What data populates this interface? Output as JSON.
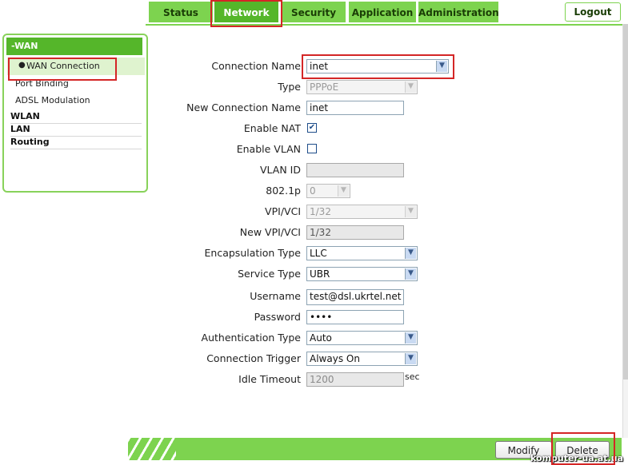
{
  "nav": {
    "tabs": [
      "Status",
      "Network",
      "Security",
      "Application",
      "Administration"
    ],
    "active_tab": "Network",
    "logout_label": "Logout"
  },
  "sidebar": {
    "section_title": "-WAN",
    "items": [
      "WAN Connection",
      "Port Binding",
      "ADSL Modulation"
    ],
    "active_item": "WAN Connection",
    "sections": [
      "WLAN",
      "LAN",
      "Routing"
    ]
  },
  "form": {
    "connection_name": {
      "label": "Connection Name",
      "value": "inet"
    },
    "type": {
      "label": "Type",
      "value": "PPPoE"
    },
    "new_connection_name": {
      "label": "New Connection Name",
      "value": "inet"
    },
    "enable_nat": {
      "label": "Enable NAT",
      "checked": true
    },
    "enable_vlan": {
      "label": "Enable VLAN",
      "checked": false
    },
    "vlan_id": {
      "label": "VLAN ID",
      "value": ""
    },
    "priority": {
      "label": "802.1p",
      "value": "0"
    },
    "vpi_vci": {
      "label": "VPI/VCI",
      "value": "1/32"
    },
    "new_vpi_vci": {
      "label": "New VPI/VCI",
      "value": "1/32"
    },
    "encapsulation": {
      "label": "Encapsulation Type",
      "value": "LLC"
    },
    "service_type": {
      "label": "Service Type",
      "value": "UBR"
    },
    "username": {
      "label": "Username",
      "value": "test@dsl.ukrtel.net"
    },
    "password": {
      "label": "Password",
      "value": "••••"
    },
    "auth_type": {
      "label": "Authentication Type",
      "value": "Auto"
    },
    "connection_trigger": {
      "label": "Connection Trigger",
      "value": "Always On"
    },
    "idle_timeout": {
      "label": "Idle Timeout",
      "value": "1200",
      "unit": "sec"
    }
  },
  "buttons": {
    "modify": "Modify",
    "delete": "Delete"
  },
  "watermark": "komputer-ua.at.ua",
  "colors": {
    "accent": "#7dd34f",
    "accent_dark": "#55b62a",
    "highlight": "#d42626"
  }
}
